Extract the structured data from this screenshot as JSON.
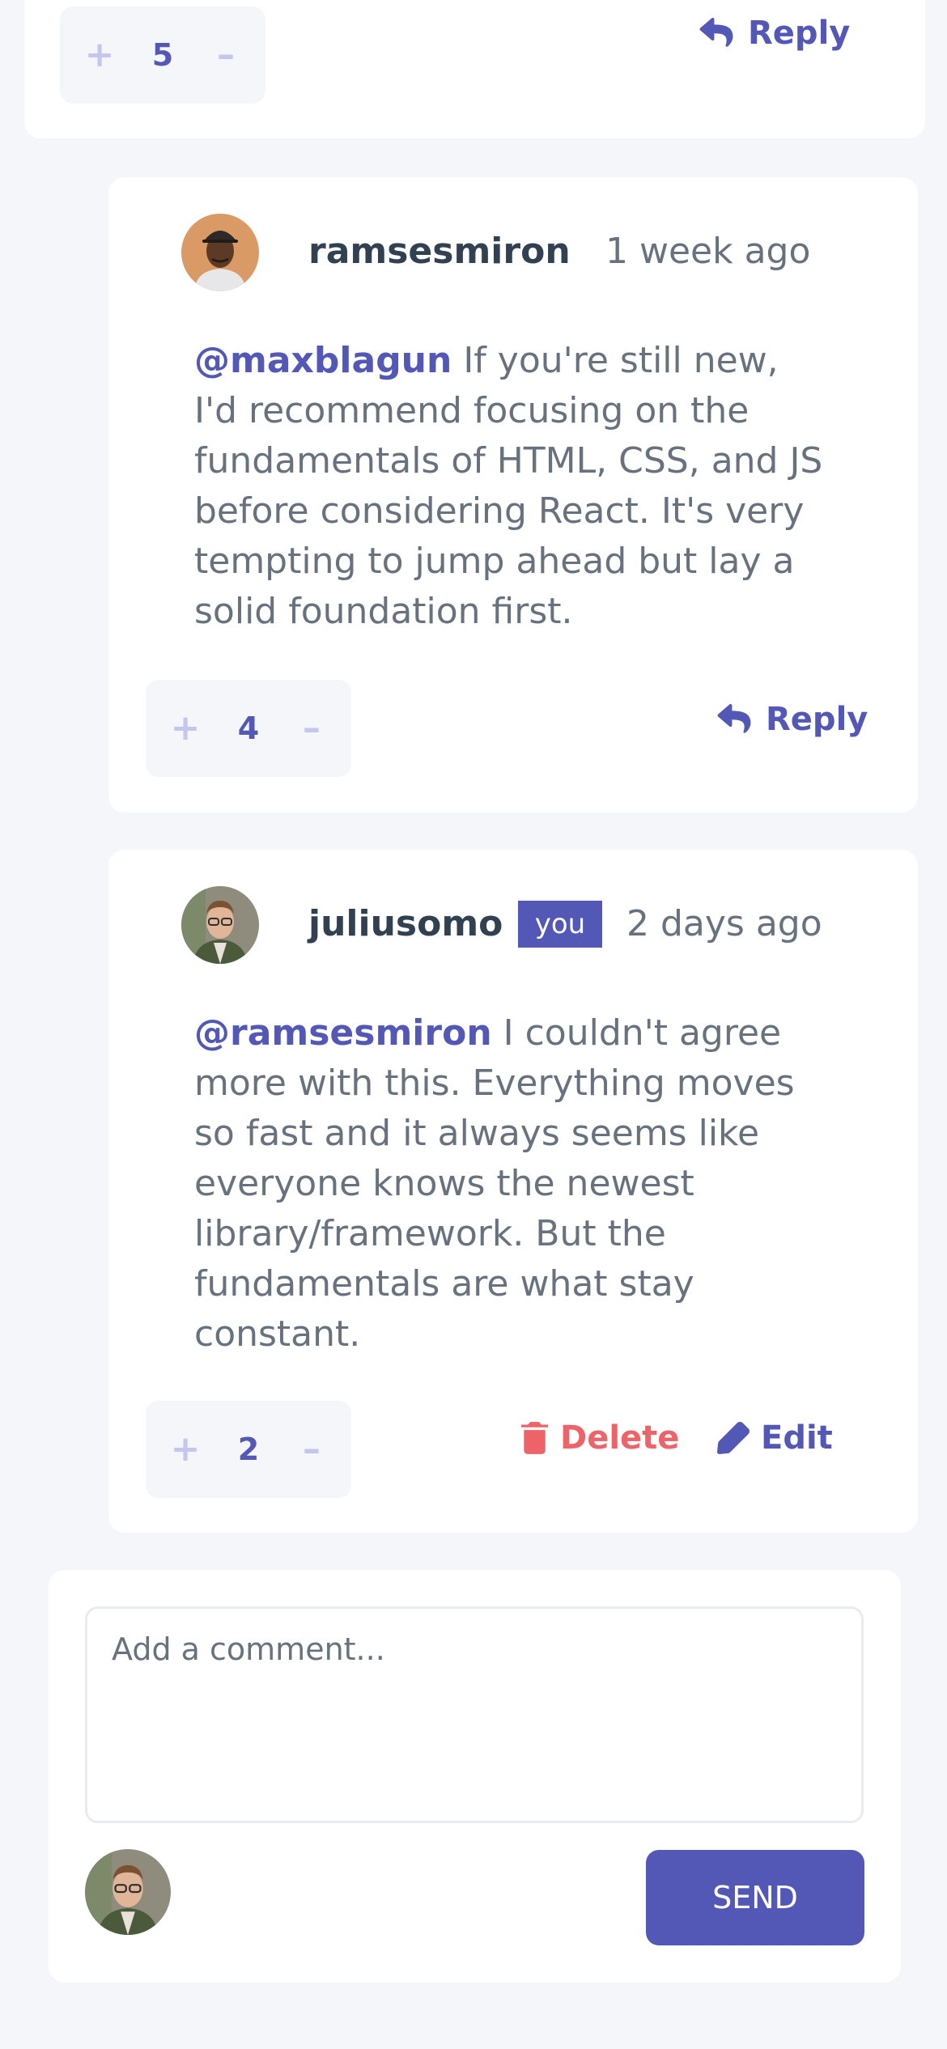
{
  "top_comment": {
    "score": "5",
    "reply_label": "Reply"
  },
  "replies": [
    {
      "username": "ramsesmiron",
      "time": "1 week ago",
      "mention": "@maxblagun",
      "text": " If you're still new, I'd recommend focusing on the fundamentals of HTML, CSS, and JS before considering React. It's very tempting to jump ahead but lay a solid foundation first.",
      "score": "4",
      "reply_label": "Reply"
    },
    {
      "username": "juliusomo",
      "badge": "you",
      "time": "2 days ago",
      "mention": "@ramsesmiron",
      "text": " I couldn't agree more with this. Everything moves so fast and it always seems like everyone knows the newest library/framework. But the fundamentals are what stay constant.",
      "score": "2",
      "delete_label": "Delete",
      "edit_label": "Edit"
    }
  ],
  "composer": {
    "placeholder": "Add a comment...",
    "send_label": "SEND"
  },
  "icons": {
    "upvote": "plus-icon",
    "downvote": "minus-icon",
    "reply": "reply-icon",
    "delete": "trash-icon",
    "edit": "pencil-icon"
  },
  "colors": {
    "primary": "#5357b6",
    "danger": "#ed6368",
    "text": "#67727e",
    "heading": "#324152",
    "background": "#f5f6fa",
    "vote_control": "#c5c6ef"
  }
}
